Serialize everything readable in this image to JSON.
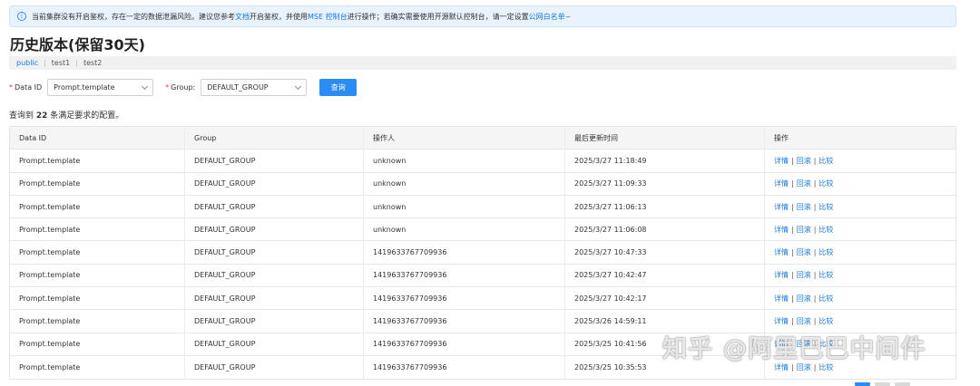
{
  "notice": {
    "part1": "当前集群没有开启鉴权，存在一定的数据泄漏风险。建议您参考",
    "link1": "文档",
    "part2": "开启鉴权，并使用",
    "link2": "MSE 控制台",
    "part3": "进行操作；若确实需要使用开源默认控制台，请一定设置",
    "link3": "公网白名单~"
  },
  "page_title": "历史版本(保留30天)",
  "namespaces": [
    "public",
    "test1",
    "test2"
  ],
  "filters": {
    "data_id_label": "Data ID",
    "data_id_value": "Prompt.template",
    "group_label": "Group:",
    "group_value": "DEFAULT_GROUP",
    "query_button": "查询"
  },
  "result": {
    "prefix": "查询到",
    "count": "22",
    "suffix": "条满足要求的配置。"
  },
  "table": {
    "headers": [
      "Data ID",
      "Group",
      "操作人",
      "最后更新时间",
      "操作"
    ],
    "actions": {
      "detail": "详情",
      "rollback": "回滚",
      "compare": "比较",
      "sep": "|"
    },
    "rows": [
      [
        "Prompt.template",
        "DEFAULT_GROUP",
        "unknown",
        "2025/3/27 11:18:49"
      ],
      [
        "Prompt.template",
        "DEFAULT_GROUP",
        "unknown",
        "2025/3/27 11:09:33"
      ],
      [
        "Prompt.template",
        "DEFAULT_GROUP",
        "unknown",
        "2025/3/27 11:06:13"
      ],
      [
        "Prompt.template",
        "DEFAULT_GROUP",
        "unknown",
        "2025/3/27 11:06:08"
      ],
      [
        "Prompt.template",
        "DEFAULT_GROUP",
        "1419633767709936",
        "2025/3/27 10:47:33"
      ],
      [
        "Prompt.template",
        "DEFAULT_GROUP",
        "1419633767709936",
        "2025/3/27 10:42:47"
      ],
      [
        "Prompt.template",
        "DEFAULT_GROUP",
        "1419633767709936",
        "2025/3/27 10:42:17"
      ],
      [
        "Prompt.template",
        "DEFAULT_GROUP",
        "1419633767709936",
        "2025/3/26 14:59:11"
      ],
      [
        "Prompt.template",
        "DEFAULT_GROUP",
        "1419633767709936",
        "2025/3/25 10:41:56"
      ],
      [
        "Prompt.template",
        "DEFAULT_GROUP",
        "1419633767709936",
        "2025/3/25 10:35:53"
      ]
    ]
  },
  "watermark": "知乎 @阿里巴巴中间件",
  "icons": {
    "notice": "info-circle-icon",
    "select": "chevron-down-icon"
  },
  "colors": {
    "link": "#1677d9",
    "primary_button": "#2b8cf4",
    "notice_bg": "#e8f3fd",
    "required": "#e0343c"
  }
}
